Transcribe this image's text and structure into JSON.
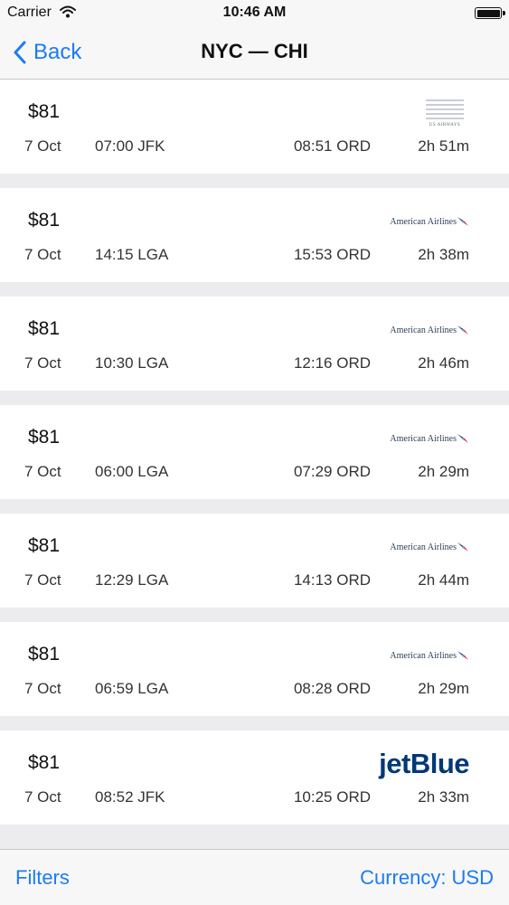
{
  "status_bar": {
    "carrier": "Carrier",
    "time": "10:46 AM"
  },
  "nav": {
    "back_label": "Back",
    "title": "NYC — CHI"
  },
  "flights": [
    {
      "price": "$81",
      "date": "7 Oct",
      "departure": "07:00 JFK",
      "arrival": "08:51 ORD",
      "duration": "2h 51m",
      "airline": "us",
      "airline_logo_text": "US AIRWAYS"
    },
    {
      "price": "$81",
      "date": "7 Oct",
      "departure": "14:15 LGA",
      "arrival": "15:53 ORD",
      "duration": "2h 38m",
      "airline": "aa",
      "airline_logo_text": "American Airlines"
    },
    {
      "price": "$81",
      "date": "7 Oct",
      "departure": "10:30 LGA",
      "arrival": "12:16 ORD",
      "duration": "2h 46m",
      "airline": "aa",
      "airline_logo_text": "American Airlines"
    },
    {
      "price": "$81",
      "date": "7 Oct",
      "departure": "06:00 LGA",
      "arrival": "07:29 ORD",
      "duration": "2h 29m",
      "airline": "aa",
      "airline_logo_text": "American Airlines"
    },
    {
      "price": "$81",
      "date": "7 Oct",
      "departure": "12:29 LGA",
      "arrival": "14:13 ORD",
      "duration": "2h 44m",
      "airline": "aa",
      "airline_logo_text": "American Airlines"
    },
    {
      "price": "$81",
      "date": "7 Oct",
      "departure": "06:59 LGA",
      "arrival": "08:28 ORD",
      "duration": "2h 29m",
      "airline": "aa",
      "airline_logo_text": "American Airlines"
    },
    {
      "price": "$81",
      "date": "7 Oct",
      "departure": "08:52 JFK",
      "arrival": "10:25 ORD",
      "duration": "2h 33m",
      "airline": "jetblue",
      "airline_logo_text": "jetBlue"
    }
  ],
  "toolbar": {
    "filters_label": "Filters",
    "currency_label": "Currency: USD"
  },
  "colors": {
    "accent": "#1c7cf2",
    "background": "#ececef",
    "card": "#ffffff"
  }
}
